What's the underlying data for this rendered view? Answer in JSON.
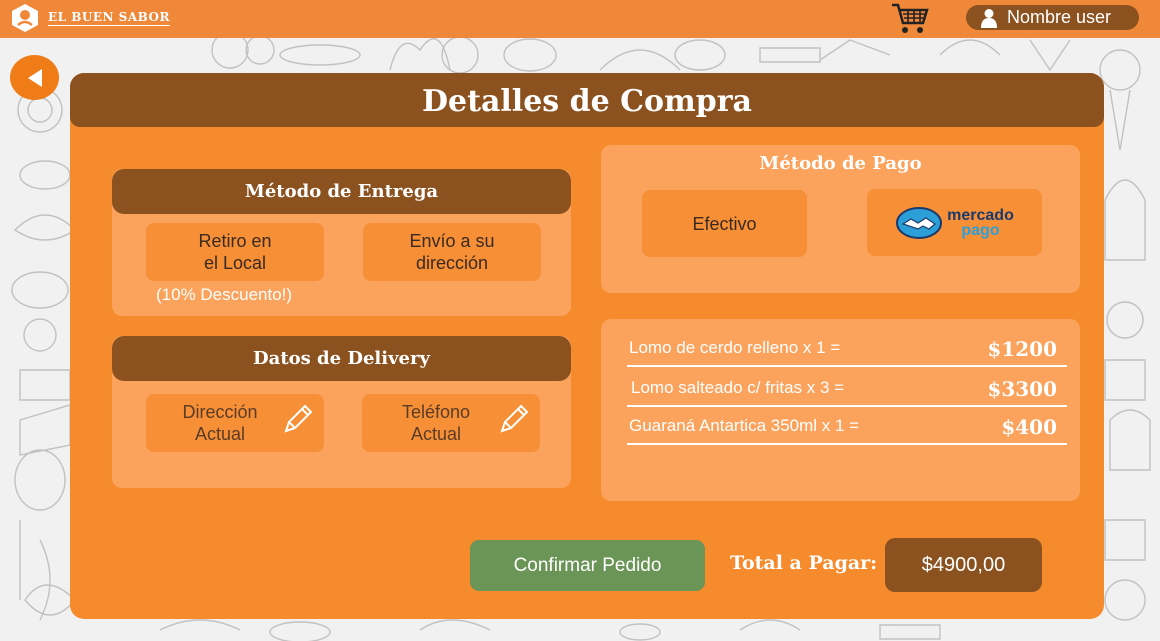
{
  "header": {
    "brand": "EL BUEN SABOR",
    "user_name": "Nombre user"
  },
  "page": {
    "title": "Detalles de Compra"
  },
  "delivery_method": {
    "title": "Método de Entrega",
    "options": [
      {
        "line1": "Retiro en",
        "line2": "el Local"
      },
      {
        "line1": "Envío a su",
        "line2": "dirección"
      }
    ],
    "discount_note": "(10% Descuento!)"
  },
  "delivery_data": {
    "title": "Datos de Delivery",
    "fields": [
      {
        "line1": "Dirección",
        "line2": "Actual"
      },
      {
        "line1": "Teléfono",
        "line2": "Actual"
      }
    ]
  },
  "payment_method": {
    "title": "Método de Pago",
    "cash_label": "Efectivo",
    "mp_line1": "mercado",
    "mp_line2": "pago"
  },
  "order": {
    "items": [
      {
        "description": "Lomo de cerdo relleno x 1 =",
        "price": "$1200"
      },
      {
        "description": "Lomo salteado c/ fritas x 3 =",
        "price": "$3300"
      },
      {
        "description": "Guaraná Antartica 350ml x 1 =",
        "price": "$400"
      }
    ]
  },
  "footer": {
    "confirm_label": "Confirmar Pedido",
    "total_label": "Total a Pagar:",
    "total_value": "$4900,00"
  },
  "colors": {
    "topbar": "#f0883a",
    "panel": "#f58b2c",
    "brown": "#8b521f",
    "card": "#fba35c",
    "option": "#f68f36",
    "confirm": "#6a9556"
  }
}
